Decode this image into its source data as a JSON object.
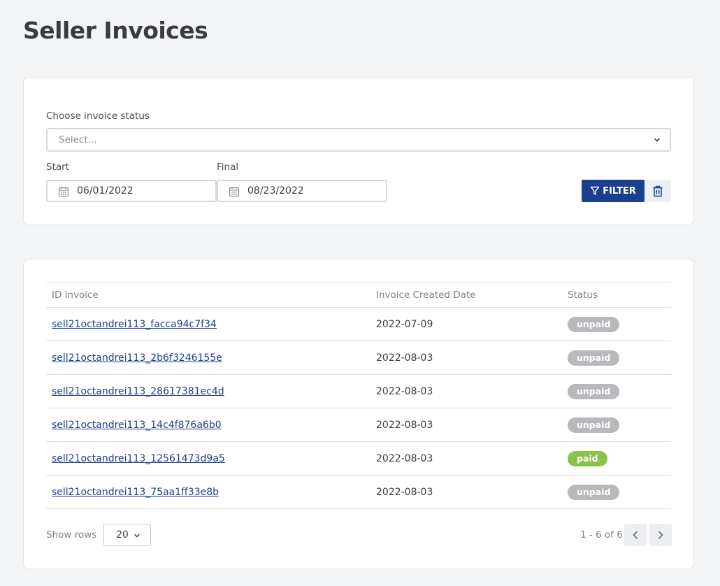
{
  "page": {
    "title": "Seller Invoices"
  },
  "filters": {
    "status_label": "Choose invoice status",
    "status_placeholder": "Select...",
    "start_label": "Start",
    "start_value": "06/01/2022",
    "final_label": "Final",
    "final_value": "08/23/2022",
    "filter_button": "FILTER"
  },
  "table": {
    "headers": [
      "ID invoice",
      "Invoice Created Date",
      "Status"
    ],
    "rows": [
      {
        "id": "sell21octandrei113_facca94c7f34",
        "date": "2022-07-09",
        "status": "unpaid"
      },
      {
        "id": "sell21octandrei113_2b6f3246155e",
        "date": "2022-08-03",
        "status": "unpaid"
      },
      {
        "id": "sell21octandrei113_28617381ec4d",
        "date": "2022-08-03",
        "status": "unpaid"
      },
      {
        "id": "sell21octandrei113_14c4f876a6b0",
        "date": "2022-08-03",
        "status": "unpaid"
      },
      {
        "id": "sell21octandrei113_12561473d9a5",
        "date": "2022-08-03",
        "status": "paid"
      },
      {
        "id": "sell21octandrei113_75aa1ff33e8b",
        "date": "2022-08-03",
        "status": "unpaid"
      }
    ]
  },
  "pagination": {
    "show_rows_label": "Show rows",
    "rows_value": "20",
    "range_text": "1 - 6 of 6"
  },
  "colors": {
    "primary": "#1a3f8e",
    "paid": "#88c34a",
    "unpaid": "#b8b9bc",
    "background": "#f3f4f6"
  },
  "icons": {
    "select_chevron": "chevron-down-icon",
    "date": "calendar-icon",
    "filter": "filter-icon",
    "clear": "trash-icon",
    "prev": "chevron-left-icon",
    "next": "chevron-right-icon"
  }
}
